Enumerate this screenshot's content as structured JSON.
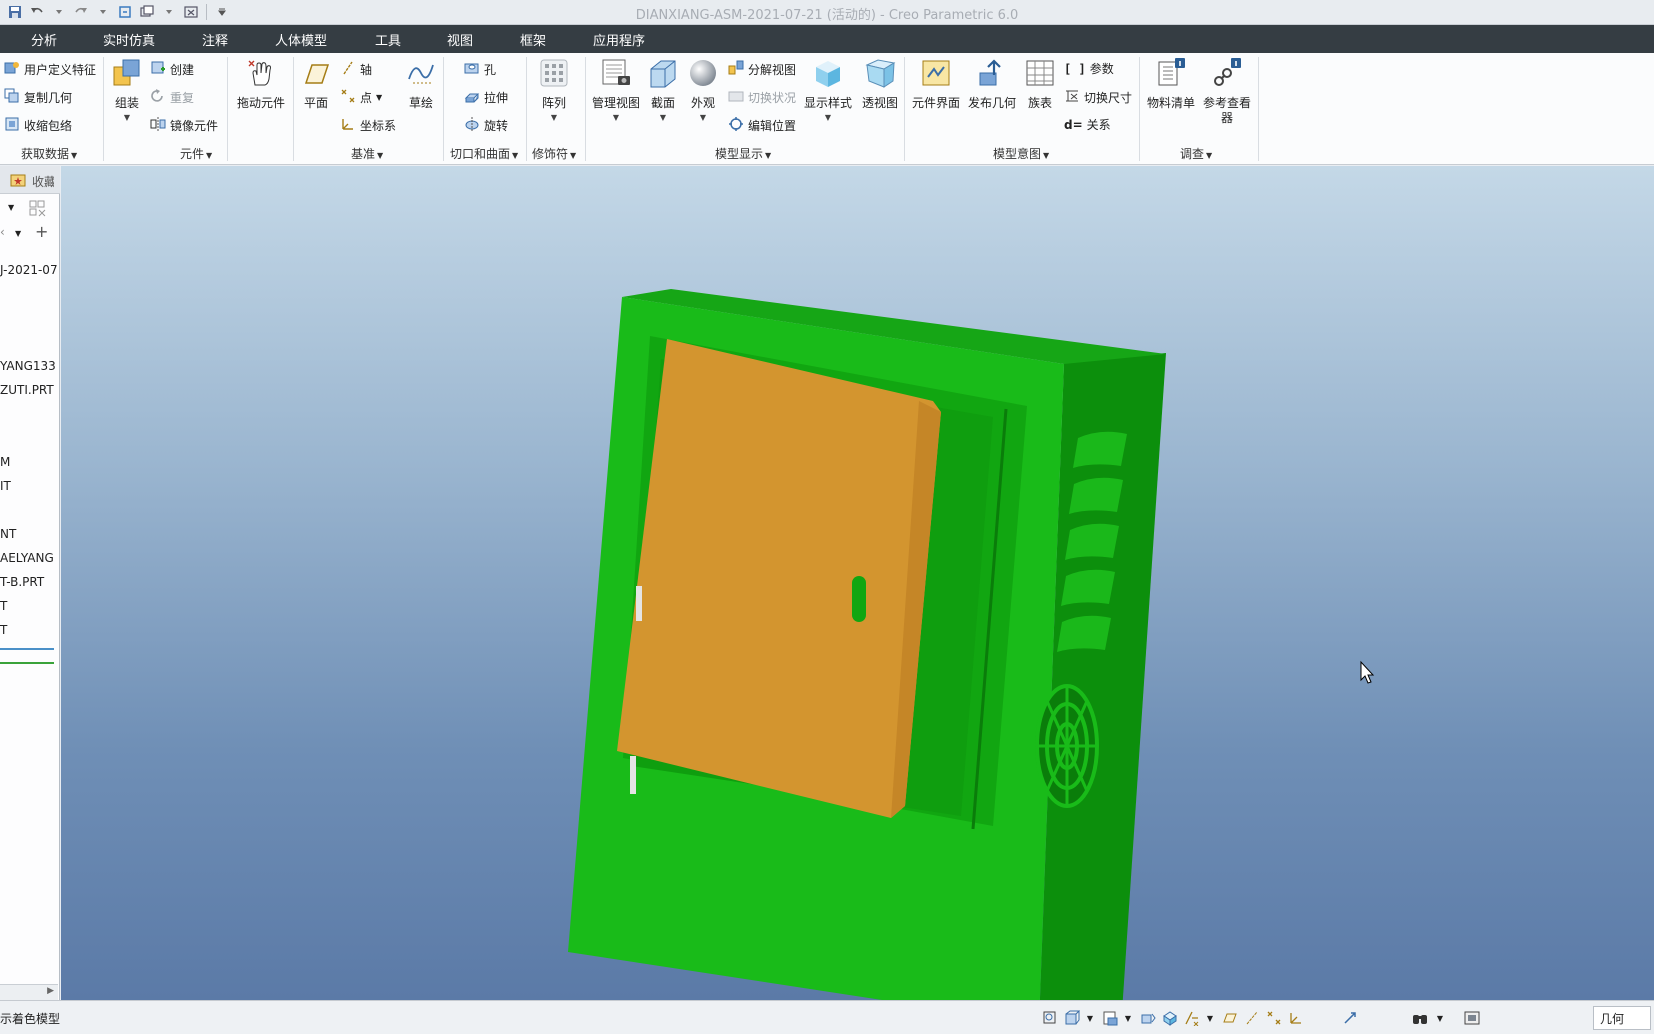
{
  "window": {
    "title": "DIANXIANG-ASM-2021-07-21 (活动的) - Creo Parametric 6.0"
  },
  "menu": {
    "tabs": [
      "分析",
      "实时仿真",
      "注释",
      "人体模型",
      "工具",
      "视图",
      "框架",
      "应用程序"
    ]
  },
  "ribbon": {
    "get_data": {
      "label": "获取数据",
      "user_feature": "用户定义特征",
      "copy_geom": "复制几何",
      "shrinkwrap": "收缩包络"
    },
    "component": {
      "label": "元件",
      "assemble": "组装",
      "create": "创建",
      "repeat": "重复",
      "mirror": "镜像元件",
      "drag": "拖动元件"
    },
    "datum": {
      "label": "基准",
      "plane": "平面",
      "axis": "轴",
      "point": "点",
      "csys": "坐标系",
      "sketch": "草绘"
    },
    "cut_surface": {
      "label": "切口和曲面",
      "hole": "孔",
      "extrude": "拉伸",
      "revolve": "旋转"
    },
    "modifiers": {
      "label": "修饰符",
      "pattern": "阵列"
    },
    "model_display": {
      "label": "模型显示",
      "manage_views": "管理视图",
      "section": "截面",
      "appearance": "外观",
      "explode_view": "分解视图",
      "toggle_status": "切换状况",
      "edit_position": "编辑位置",
      "display_style": "显示样式",
      "perspective": "透视图"
    },
    "model_intent": {
      "label": "模型意图",
      "component_interface": "元件界面",
      "publish_geom": "发布几何",
      "family_table": "族表",
      "parameters": "参数",
      "switch_dims": "切换尺寸",
      "relations": "关系"
    },
    "investigate": {
      "label": "调查",
      "bom": "物料清单",
      "ref_viewer": "参考查看器"
    }
  },
  "tree": {
    "header_label": "收藏",
    "items": [
      "J-2021-07",
      "YANG133",
      "ZUTI.PRT",
      "M",
      "IT",
      "NT",
      "AELYANG",
      "T-B.PRT",
      "T",
      "T"
    ]
  },
  "status": {
    "message": "示着色模型",
    "filter": "几何"
  },
  "colors": {
    "menubar": "#353d43",
    "box_green": "#14b814",
    "door_orange": "#d3952f"
  }
}
